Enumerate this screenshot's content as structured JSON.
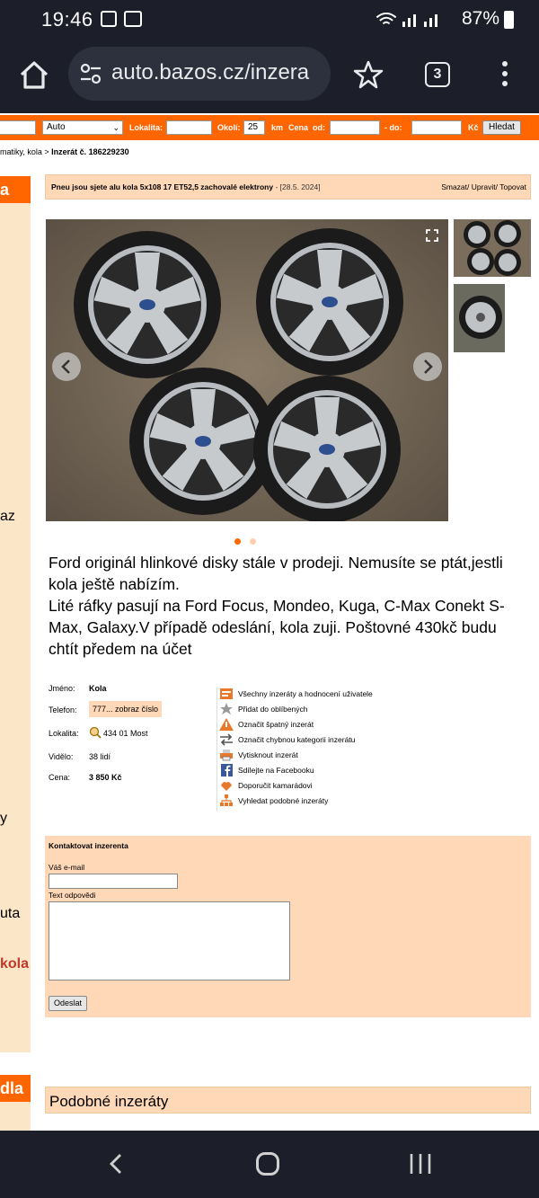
{
  "status_bar": {
    "time": "19:46",
    "battery": "87%"
  },
  "browser": {
    "url": "auto.bazos.cz/inzera",
    "tab_count": "3"
  },
  "search": {
    "category_value": "Auto",
    "lokalita_label": "Lokalita:",
    "okoli_label": "Okolí:",
    "okoli_value": "25",
    "km_label": "km",
    "cena_label": "Cena",
    "od_label": "od:",
    "do_label": "- do:",
    "currency": "Kč",
    "submit": "Hledat"
  },
  "breadcrumb": {
    "prefix": "matiky, kola > ",
    "current": "Inzerát č. 186229230"
  },
  "sidebar_fragments": {
    "head1": "a",
    "frag1": "az",
    "frag2": "y",
    "frag3": "uta",
    "frag4": "kola",
    "head2": "dla"
  },
  "listing": {
    "title": "Pneu jsou sjete alu kola 5x108 17 ET52,5 zachovalé elektrony",
    "date": "- [28.5. 2024]",
    "actions": "Smazat/ Upravit/ Topovat",
    "description": [
      "Ford originál hlinkové disky stále v prodeji. Nemusíte se ptát,jestli kola ještě nabízím.",
      "Lité ráfky pasují na Ford Focus, Mondeo, Kuga, C-Max Conekt S-Max, Galaxy.V případě odeslání, kola zuji. Poštovné 430kč budu chtít předem na účet"
    ],
    "photo_count": 2,
    "active_photo": 1
  },
  "info": {
    "name_label": "Jméno:",
    "name_value": "Kola",
    "phone_label": "Telefon:",
    "phone_value": "777... zobraz číslo",
    "location_label": "Lokalita:",
    "location_value": "434 01 Most",
    "views_label": "Vidělo:",
    "views_value": "38 lidí",
    "price_label": "Cena:",
    "price_value": "3 850 Kč"
  },
  "links": [
    {
      "icon": "user-ads-icon",
      "label": "Všechny inzeráty a hodnocení uživatele"
    },
    {
      "icon": "star-icon",
      "label": "Přidat do oblíbených"
    },
    {
      "icon": "warning-icon",
      "label": "Označit špatný inzerát"
    },
    {
      "icon": "swap-arrows-icon",
      "label": "Označit chybnou kategorii inzerátu"
    },
    {
      "icon": "printer-icon",
      "label": "Vytisknout inzerát"
    },
    {
      "icon": "facebook-icon",
      "label": "Sdílejte na Facebooku"
    },
    {
      "icon": "recommend-icon",
      "label": "Doporučit kamarádovi"
    },
    {
      "icon": "similar-icon",
      "label": "Vyhledat podobné inzeráty"
    }
  ],
  "contact": {
    "heading": "Kontaktovat inzerenta",
    "email_label": "Váš e-mail",
    "text_label": "Text odpovědi",
    "submit": "Odeslat"
  },
  "similar": {
    "heading": "Podobné inzeráty"
  },
  "colors": {
    "accent": "#ff6600",
    "panel": "#ffd8b8",
    "sidebar": "#fce6c8",
    "chrome": "#1c1f2a"
  }
}
